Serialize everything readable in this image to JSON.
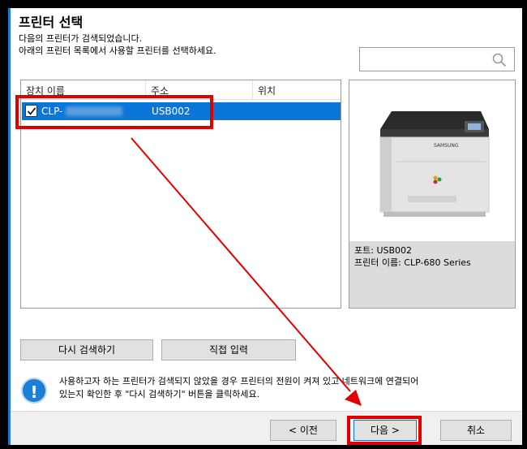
{
  "window": {
    "title": "프린터 선택",
    "description_line1": "다음의 프린터가 검색되었습니다.",
    "description_line2": "아래의 프린터 목록에서 사용할 프린터를 선택하세요."
  },
  "search": {
    "placeholder": "",
    "value": ""
  },
  "printer_list": {
    "columns": [
      "장치 이름",
      "주소",
      "위치"
    ],
    "rows": [
      {
        "name": "CLP-",
        "address": "USB002",
        "location": "",
        "checked": true,
        "selected": true
      }
    ]
  },
  "preview": {
    "port_line": "포트: USB002",
    "name_line": "프린터 이름: CLP-680 Series",
    "brand": "SAMSUNG"
  },
  "buttons": {
    "rescan": "다시 검색하기",
    "direct_input": "직접 입력",
    "back": "< 이전",
    "next": "다음 >",
    "cancel": "취소"
  },
  "info": {
    "line1": "사용하고자 하는 프린터가 검색되지 않았을 경우 프린터의 전원이 켜져 있고 네트워크에 연결되어",
    "line2": "있는지 확인한 후 \"다시 검색하기\" 버튼을 클릭하세요."
  },
  "colors": {
    "selection": "#0a76d8",
    "highlight": "#e00000",
    "info_icon": "#1c7ed6"
  }
}
